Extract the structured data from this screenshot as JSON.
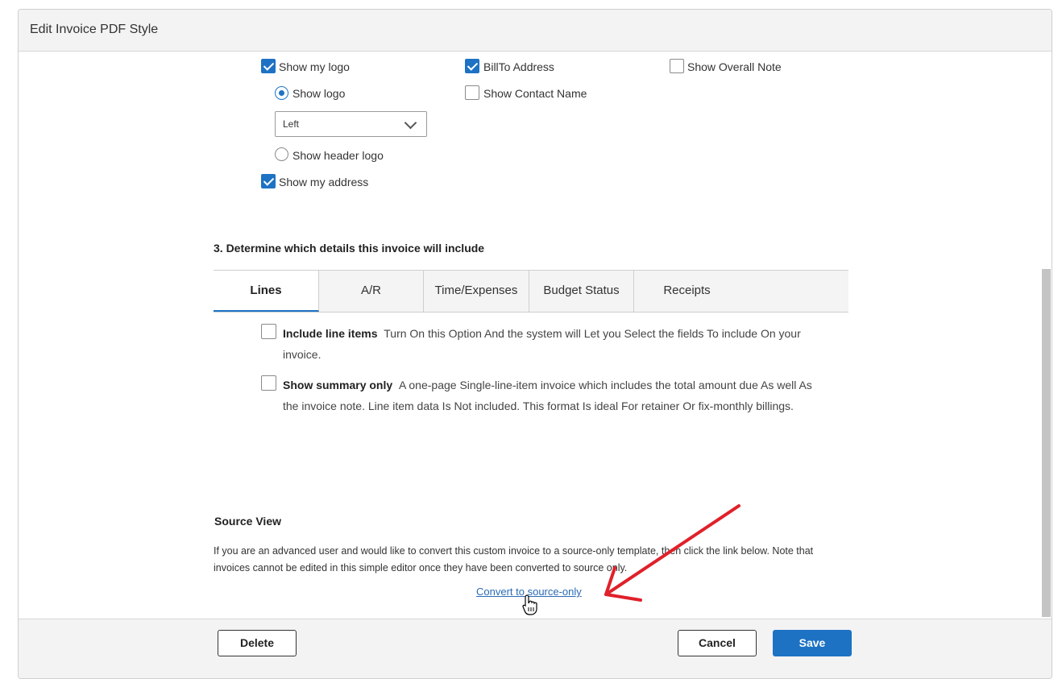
{
  "dialog": {
    "title": "Edit Invoice PDF Style"
  },
  "options": {
    "show_my_logo": {
      "label": "Show my logo",
      "checked": true
    },
    "show_logo": {
      "label": "Show logo",
      "selected": true
    },
    "logo_position": {
      "value": "Left"
    },
    "show_header_logo": {
      "label": "Show header logo",
      "selected": false
    },
    "show_my_address": {
      "label": "Show my address",
      "checked": true
    },
    "billto_address": {
      "label": "BillTo Address",
      "checked": true
    },
    "show_contact_name": {
      "label": "Show Contact Name",
      "checked": false
    },
    "show_overall_note": {
      "label": "Show Overall Note",
      "checked": false
    }
  },
  "details": {
    "title": "3. Determine which details this invoice will include",
    "tabs": [
      "Lines",
      "A/R",
      "Time/Expenses",
      "Budget Status",
      "Receipts"
    ],
    "active_tab": "Lines",
    "include_line_items": {
      "label": "Include line items",
      "description": "Turn On this Option And the system will Let you Select the fields To include On your invoice.",
      "checked": false
    },
    "show_summary_only": {
      "label": "Show summary only",
      "description": "A one-page Single-line-item invoice which includes the total amount due As well As the invoice note. Line item data Is Not included. This format Is ideal For retainer Or fix-monthly billings.",
      "checked": false
    }
  },
  "source_view": {
    "title": "Source View",
    "description": "If you are an advanced user and would like to convert this custom invoice to a source-only template, then click the link below. Note that invoices cannot be edited in this simple editor once they have been converted to source only.",
    "link": "Convert to source-only"
  },
  "footer": {
    "delete": "Delete",
    "cancel": "Cancel",
    "save": "Save"
  },
  "colors": {
    "accent": "#1d72c4",
    "annotation": "#e0202a"
  },
  "icons": {
    "dropdown": "chevron-down-icon",
    "pointer": "hand-cursor-icon",
    "annotation": "red-arrow"
  }
}
